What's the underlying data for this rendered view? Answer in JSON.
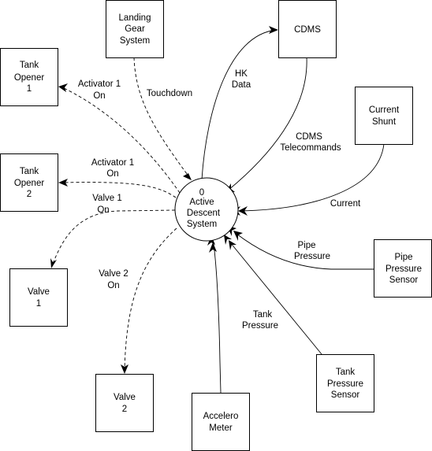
{
  "diagram": {
    "type": "data-flow-diagram",
    "process": {
      "number": "0",
      "lines": [
        "Active",
        "Descent",
        "System"
      ]
    },
    "entities": {
      "landing_gear": [
        "Landing",
        "Gear",
        "System"
      ],
      "cdms": [
        "CDMS"
      ],
      "tank_opener_1": [
        "Tank",
        "Opener",
        "1"
      ],
      "current_shunt": [
        "Current",
        "Shunt"
      ],
      "tank_opener_2": [
        "Tank",
        "Opener",
        "2"
      ],
      "valve_1": [
        "Valve",
        "1"
      ],
      "pipe_pressure_sensor": [
        "Pipe",
        "Pressure",
        "Sensor"
      ],
      "valve_2": [
        "Valve",
        "2"
      ],
      "tank_pressure_sensor": [
        "Tank",
        "Pressure",
        "Sensor"
      ],
      "accelero_meter": [
        "Accelero",
        "Meter"
      ]
    },
    "flows": {
      "touchdown": [
        "Touchdown"
      ],
      "hk_data": [
        "HK",
        "Data"
      ],
      "cdms_telecommands": [
        "CDMS",
        "Telecommands"
      ],
      "current": [
        "Current"
      ],
      "pipe_pressure": [
        "Pipe",
        "Pressure"
      ],
      "tank_pressure": [
        "Tank",
        "Pressure"
      ],
      "activator_1_on_a": [
        "Activator 1",
        "On"
      ],
      "activator_1_on_b": [
        "Activator 1",
        "On"
      ],
      "valve_1_on": [
        "Valve 1",
        "On"
      ],
      "valve_2_on": [
        "Valve 2",
        "On"
      ]
    }
  }
}
